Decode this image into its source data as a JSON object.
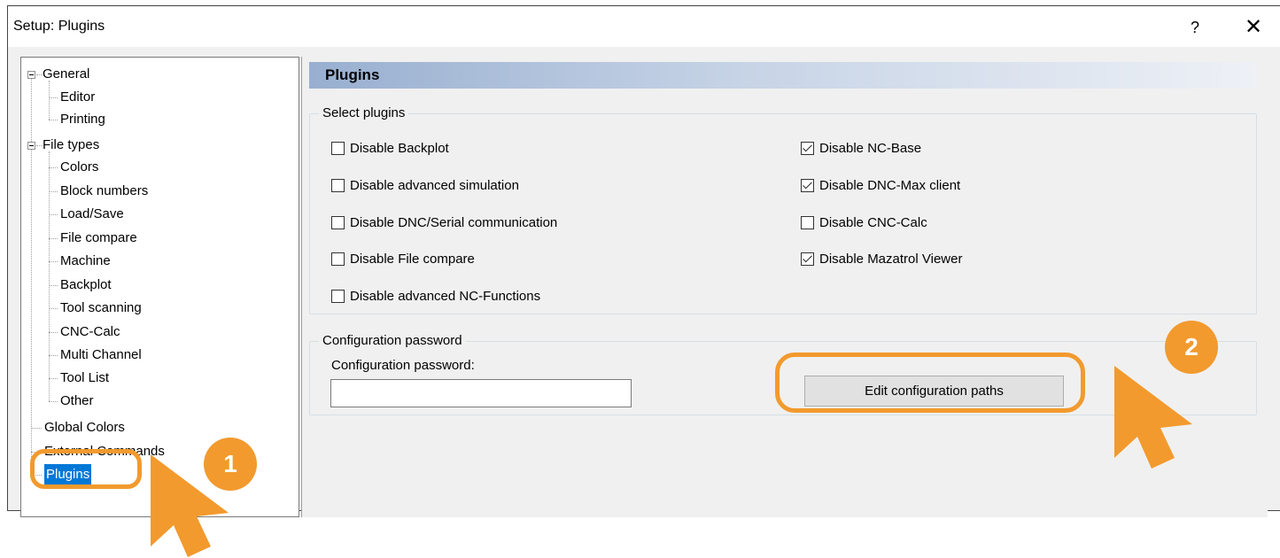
{
  "window": {
    "title": "Setup: Plugins",
    "help_label": "?",
    "close_label": "✕"
  },
  "tree": {
    "items": [
      {
        "label": "General"
      },
      {
        "label": "Editor"
      },
      {
        "label": "Printing"
      },
      {
        "label": "File types"
      },
      {
        "label": "Colors"
      },
      {
        "label": "Block numbers"
      },
      {
        "label": "Load/Save"
      },
      {
        "label": "File compare"
      },
      {
        "label": "Machine"
      },
      {
        "label": "Backplot"
      },
      {
        "label": "Tool scanning"
      },
      {
        "label": "CNC-Calc"
      },
      {
        "label": "Multi Channel"
      },
      {
        "label": "Tool List"
      },
      {
        "label": "Other"
      },
      {
        "label": "Global Colors"
      },
      {
        "label": "External Commands"
      },
      {
        "label": "Plugins"
      }
    ],
    "selected": "Plugins"
  },
  "panel": {
    "title": "Plugins",
    "select_group_label": "Select plugins",
    "plugins_left": [
      {
        "label": "Disable Backplot",
        "checked": false
      },
      {
        "label": "Disable advanced simulation",
        "checked": false
      },
      {
        "label": "Disable DNC/Serial communication",
        "checked": false
      },
      {
        "label": "Disable File compare",
        "checked": false
      },
      {
        "label": "Disable advanced NC-Functions",
        "checked": false
      }
    ],
    "plugins_right": [
      {
        "label": "Disable NC-Base",
        "checked": true
      },
      {
        "label": "Disable DNC-Max client",
        "checked": true
      },
      {
        "label": "Disable CNC-Calc",
        "checked": false
      },
      {
        "label": "Disable Mazatrol Viewer",
        "checked": true
      }
    ],
    "password_group_label": "Configuration password",
    "password_label": "Configuration password:",
    "password_value": "",
    "edit_button_label": "Edit configuration paths"
  },
  "annotations": {
    "step1": "1",
    "step2": "2",
    "accent_color": "#f29a2e"
  }
}
